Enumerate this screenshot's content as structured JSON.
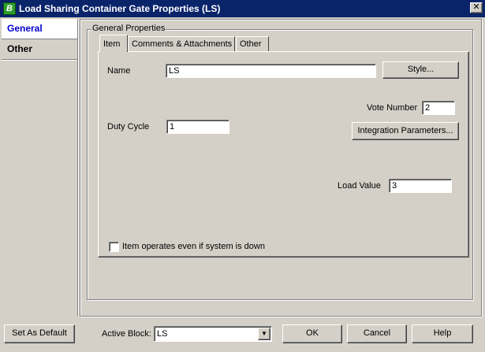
{
  "window": {
    "title": "Load Sharing Container Gate Properties (LS)",
    "app_icon_letter": "B",
    "close_glyph": "✕"
  },
  "nav": {
    "items": [
      {
        "label": "General",
        "selected": true
      },
      {
        "label": "Other",
        "selected": false
      }
    ]
  },
  "group": {
    "legend": "General Properties"
  },
  "tabs": [
    {
      "label": "Item",
      "active": true
    },
    {
      "label": "Comments & Attachments",
      "active": false
    },
    {
      "label": "Other",
      "active": false
    }
  ],
  "item_tab": {
    "name_label": "Name",
    "name_value": "LS",
    "style_button": "Style...",
    "vote_number_label": "Vote Number",
    "vote_number_value": "2",
    "duty_cycle_label": "Duty Cycle",
    "duty_cycle_value": "1",
    "integration_button": "Integration Parameters...",
    "load_value_label": "Load Value",
    "load_value_value": "3",
    "operates_checkbox_label": "Item operates even if system is down",
    "operates_checked": false
  },
  "footer": {
    "set_default_button": "Set As Default",
    "active_block_label": "Active Block:",
    "active_block_value": "LS",
    "ok_button": "OK",
    "cancel_button": "Cancel",
    "help_button": "Help"
  }
}
